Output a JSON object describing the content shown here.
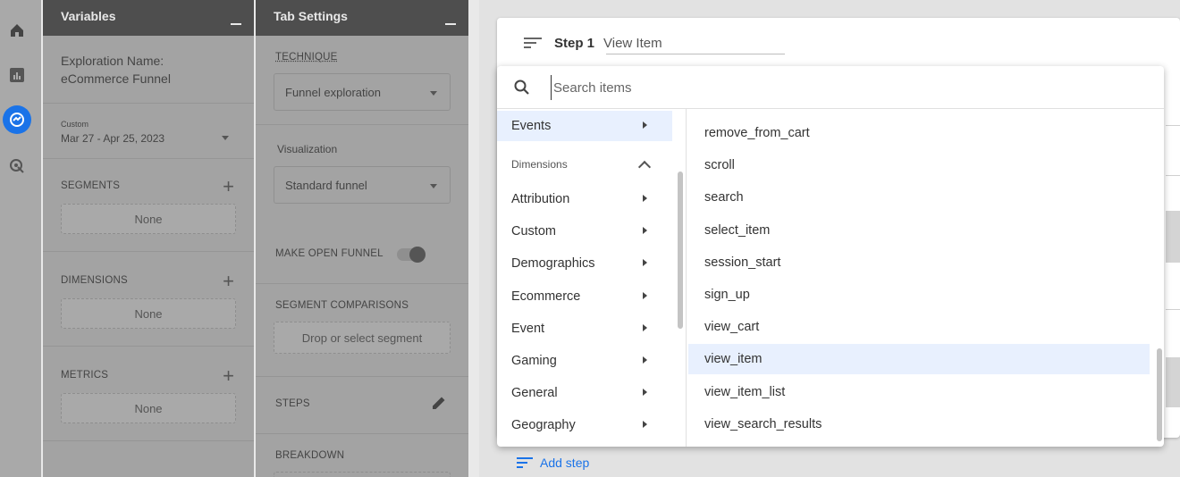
{
  "rail": {
    "icons": [
      "home-icon",
      "reports-icon",
      "explore-icon",
      "advertising-icon"
    ],
    "accent": "#1a73e8"
  },
  "variables": {
    "title": "Variables",
    "exploration_label": "Exploration Name:",
    "exploration_name": "eCommerce Funnel",
    "date_tag": "Custom",
    "date_range": "Mar 27 - Apr 25, 2023",
    "segments_label": "SEGMENTS",
    "segments_value": "None",
    "dimensions_label": "DIMENSIONS",
    "dimensions_value": "None",
    "metrics_label": "METRICS",
    "metrics_value": "None"
  },
  "tab_settings": {
    "title": "Tab Settings",
    "technique_label": "TECHNIQUE",
    "technique_value": "Funnel exploration",
    "visualization_label": "Visualization",
    "visualization_value": "Standard funnel",
    "open_funnel_label": "MAKE OPEN FUNNEL",
    "segment_comparisons_label": "SEGMENT COMPARISONS",
    "segment_drop": "Drop or select segment",
    "steps_label": "STEPS",
    "breakdown_label": "BREAKDOWN"
  },
  "step": {
    "label": "Step 1",
    "name": "View Item"
  },
  "search": {
    "placeholder": "Search items"
  },
  "categories": {
    "events": "Events",
    "dimensions_group": "Dimensions",
    "items": [
      "Attribution",
      "Custom",
      "Demographics",
      "Ecommerce",
      "Event",
      "Gaming",
      "General",
      "Geography"
    ]
  },
  "event_items": [
    "remove_from_cart",
    "scroll",
    "search",
    "select_item",
    "session_start",
    "sign_up",
    "view_cart",
    "view_item",
    "view_item_list",
    "view_search_results"
  ],
  "selected_item": "view_item",
  "add_step": "Add step"
}
